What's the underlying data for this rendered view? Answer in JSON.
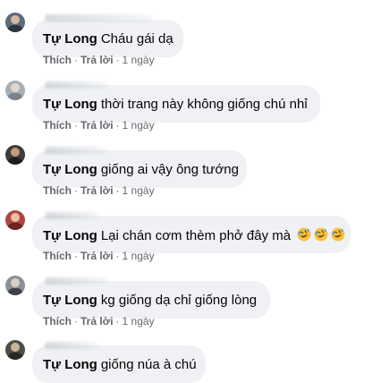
{
  "comments": [
    {
      "author": "Tự Long",
      "text": "Cháu gái dạ",
      "like": "Thích",
      "reply": "Trả lời",
      "time": "1 ngày",
      "avatar_color": "#5b6b7a"
    },
    {
      "author": "Tự Long",
      "text": "thời trang này không giống chú nhỉ",
      "like": "Thích",
      "reply": "Trả lời",
      "time": "1 ngày",
      "avatar_color": "#a8aeb5"
    },
    {
      "author": "Tự Long",
      "text": "giống ai vậy ông tướng",
      "like": "Thích",
      "reply": "Trả lời",
      "time": "1 ngày",
      "avatar_color": "#3f3b3a"
    },
    {
      "author": "Tự Long",
      "text": "Lại chán cơm thèm phở đây mà",
      "like": "Thích",
      "reply": "Trả lời",
      "time": "1 ngày",
      "avatar_color": "#b0473e",
      "emoji": "rolling-laughing-emoji"
    },
    {
      "author": "Tự Long",
      "text": "kg giống dạ chỉ giống lòng",
      "like": "Thích",
      "reply": "Trả lời",
      "time": "1 ngày",
      "avatar_color": "#8c9196"
    },
    {
      "author": "Tự Long",
      "text": "giống núa à chú",
      "avatar_color": "#4a4f46"
    }
  ],
  "colors": {
    "bubble": "#eff1f4",
    "meta": "#65676b",
    "text": "#050505"
  }
}
